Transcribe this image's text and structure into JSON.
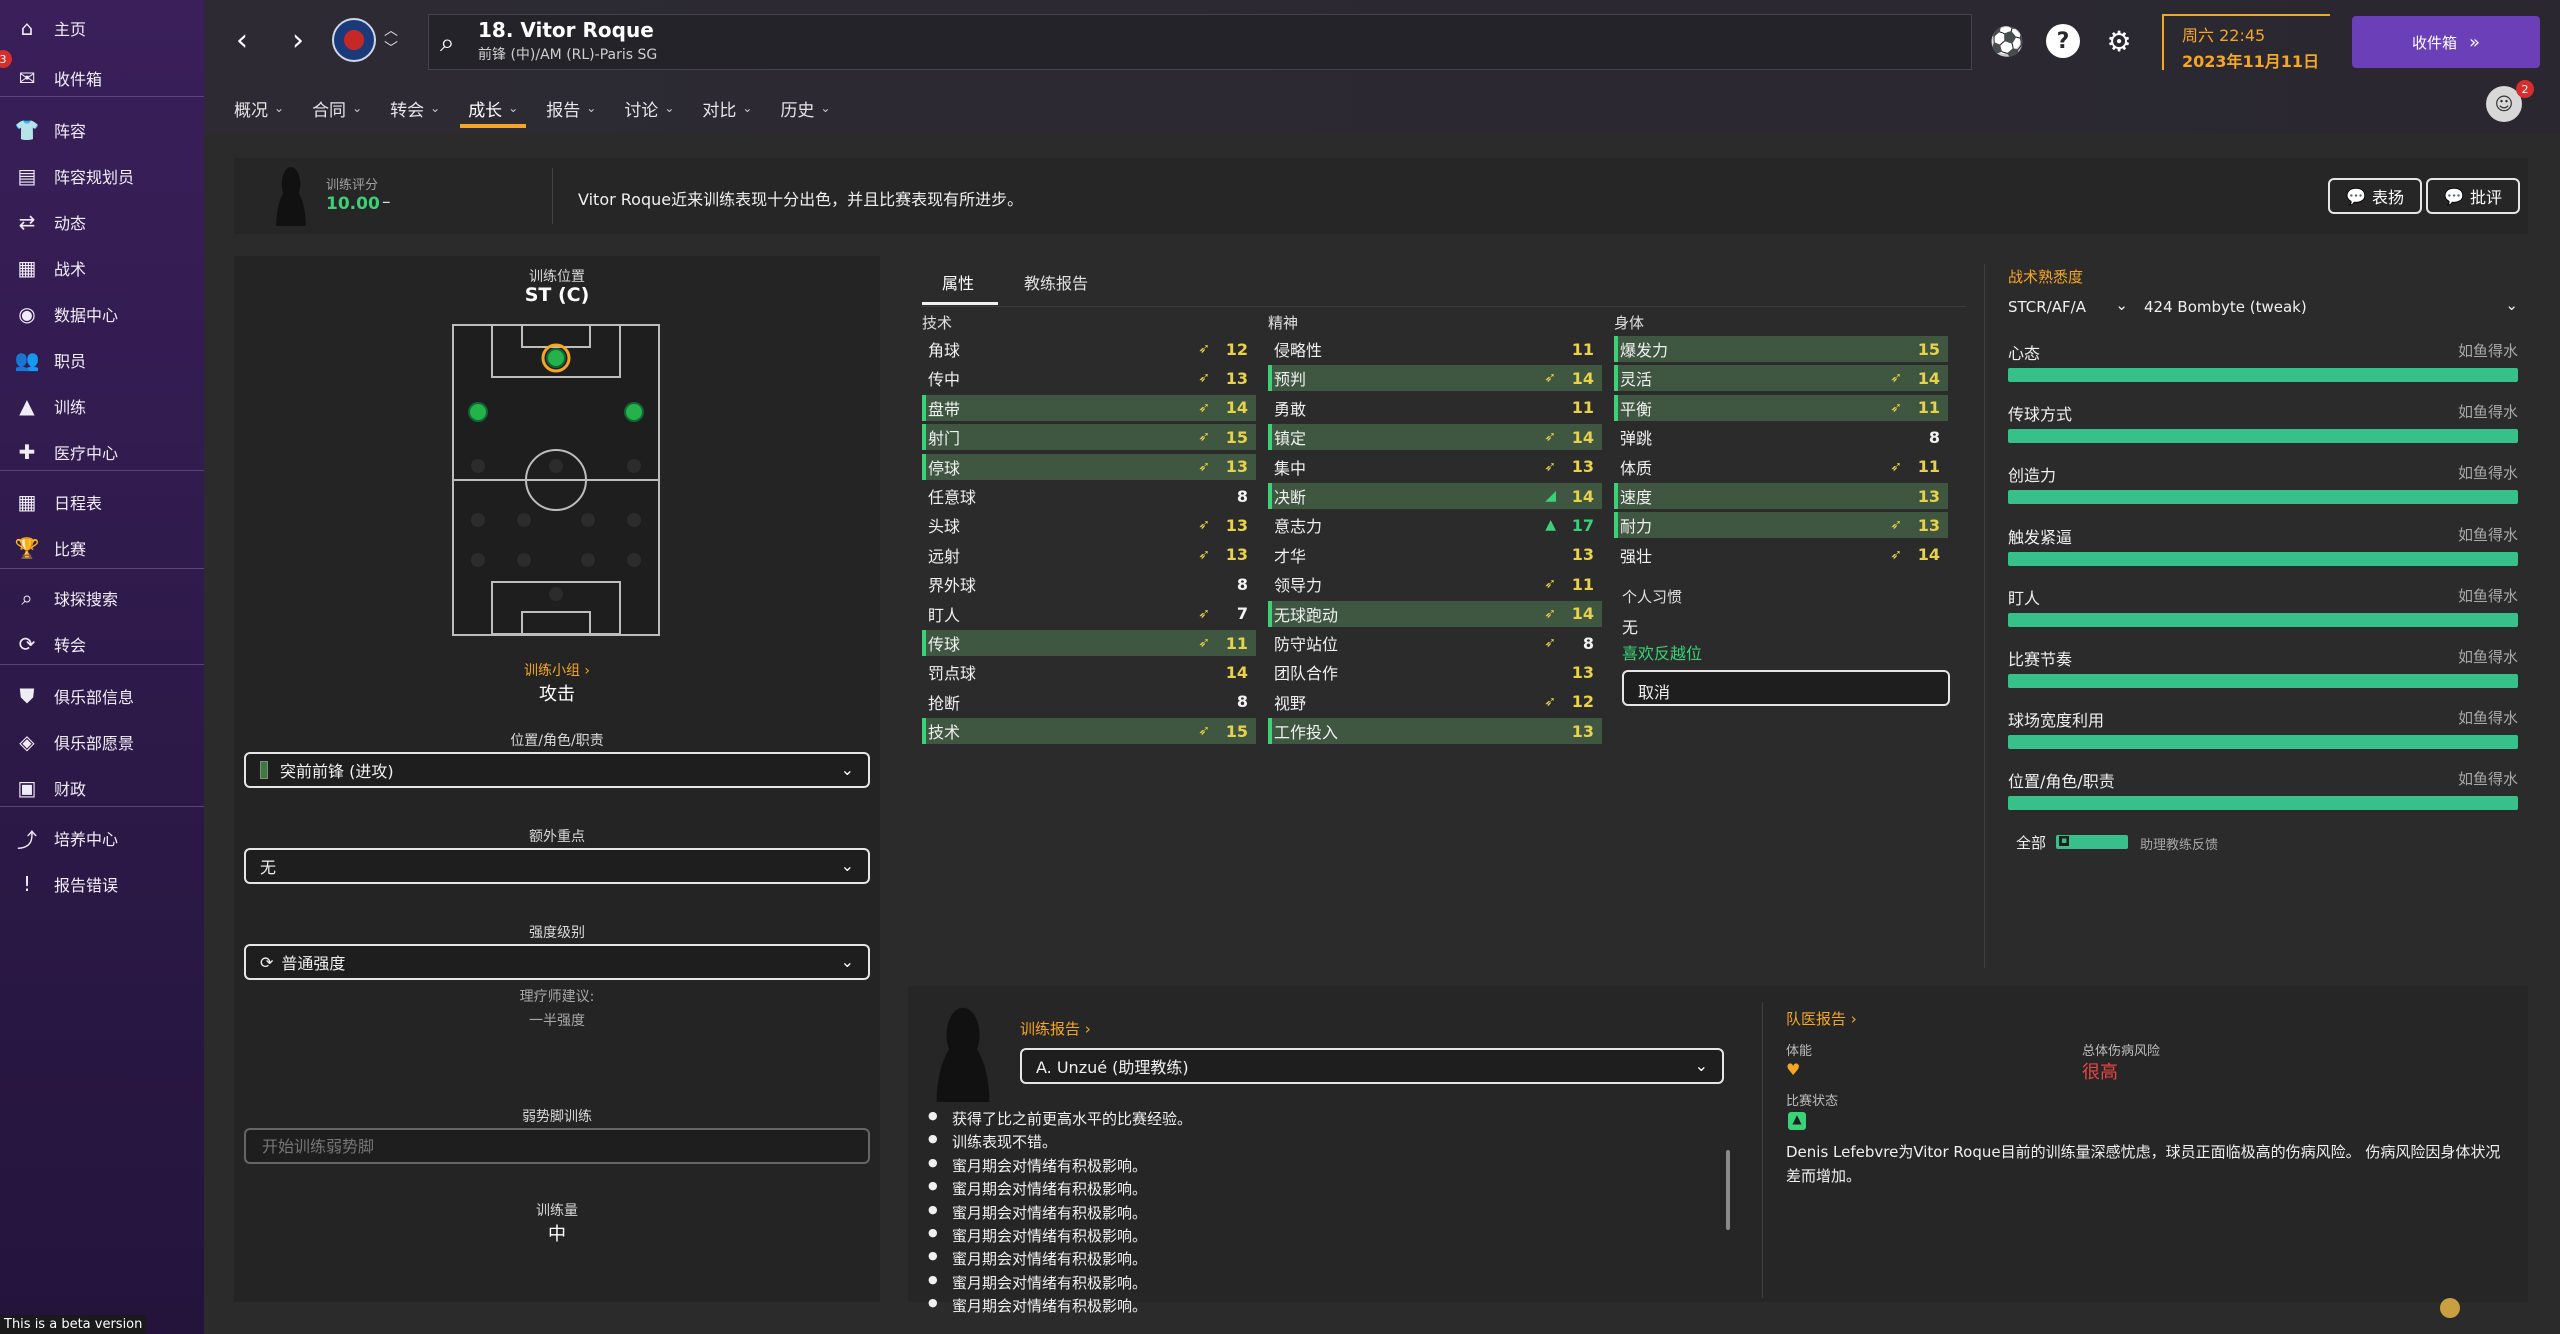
{
  "sidebar": {
    "items": [
      {
        "label": "主页",
        "icon": "home-icon",
        "glyph": "⌂"
      },
      {
        "label": "收件箱",
        "icon": "inbox-icon",
        "glyph": "✉",
        "badge": "3"
      },
      {
        "label": "阵容",
        "icon": "squad-icon",
        "glyph": "👕"
      },
      {
        "label": "阵容规划员",
        "icon": "squad-planner-icon",
        "glyph": "▤"
      },
      {
        "label": "动态",
        "icon": "dynamics-icon",
        "glyph": "⇄"
      },
      {
        "label": "战术",
        "icon": "tactics-icon",
        "glyph": "▦"
      },
      {
        "label": "数据中心",
        "icon": "data-hub-icon",
        "glyph": "◉"
      },
      {
        "label": "职员",
        "icon": "staff-icon",
        "glyph": "👥"
      },
      {
        "label": "训练",
        "icon": "training-icon",
        "glyph": "▲"
      },
      {
        "label": "医疗中心",
        "icon": "medical-icon",
        "glyph": "✚"
      },
      {
        "label": "日程表",
        "icon": "schedule-icon",
        "glyph": "▦"
      },
      {
        "label": "比赛",
        "icon": "competitions-icon",
        "glyph": "🏆"
      },
      {
        "label": "球探搜索",
        "icon": "scouting-icon",
        "glyph": "⌕"
      },
      {
        "label": "转会",
        "icon": "transfers-icon",
        "glyph": "⟳"
      },
      {
        "label": "俱乐部信息",
        "icon": "club-info-icon",
        "glyph": "⛊"
      },
      {
        "label": "俱乐部愿景",
        "icon": "club-vision-icon",
        "glyph": "◈"
      },
      {
        "label": "财政",
        "icon": "finances-icon",
        "glyph": "▣"
      },
      {
        "label": "培养中心",
        "icon": "development-icon",
        "glyph": "⤴"
      },
      {
        "label": "报告错误",
        "icon": "report-bug-icon",
        "glyph": "!"
      }
    ],
    "beta": "This is a beta version"
  },
  "header": {
    "title": "18. Vitor Roque",
    "subtitle": "前锋 (中)/AM (RL)-Paris SG",
    "time": "周六 22:45",
    "date": "2023年11月11日",
    "inbox": "收件箱",
    "manager_badge": "2",
    "menu": [
      {
        "label": "概况"
      },
      {
        "label": "合同"
      },
      {
        "label": "转会"
      },
      {
        "label": "成长"
      },
      {
        "label": "报告"
      },
      {
        "label": "讨论"
      },
      {
        "label": "对比"
      },
      {
        "label": "历史"
      }
    ]
  },
  "rating": {
    "label": "训练评分",
    "value": "10.00",
    "trend": "–",
    "comment": "Vitor Roque近来训练表现十分出色，并且比赛表现有所进步。",
    "praise": "表扬",
    "criticise": "批评"
  },
  "left": {
    "position_label": "训练位置",
    "position_value": "ST (C)",
    "unit_label": "训练小组",
    "unit_value": "攻击",
    "role_label": "位置/角色/职责",
    "role_value": "突前前锋 (进攻)",
    "extra_label": "额外重点",
    "extra_value": "无",
    "intensity_label": "强度级别",
    "intensity_value": "普通强度",
    "physio_label": "理疗师建议:",
    "physio_value": "一半强度",
    "weakfoot_label": "弱势脚训练",
    "weakfoot_placeholder": "开始训练弱势脚",
    "load_label": "训练量",
    "load_value": "中"
  },
  "attributes": {
    "tabs": [
      "属性",
      "教练报告"
    ],
    "technical_head": "技术",
    "mental_head": "精神",
    "physical_head": "身体",
    "technical": [
      {
        "name": "角球",
        "value": "12",
        "arrow": "up",
        "hl": false
      },
      {
        "name": "传中",
        "value": "13",
        "arrow": "up",
        "hl": false
      },
      {
        "name": "盘带",
        "value": "14",
        "arrow": "up",
        "hl": true
      },
      {
        "name": "射门",
        "value": "15",
        "arrow": "up",
        "hl": true
      },
      {
        "name": "停球",
        "value": "13",
        "arrow": "up",
        "hl": true
      },
      {
        "name": "任意球",
        "value": "8",
        "arrow": "",
        "hl": false
      },
      {
        "name": "头球",
        "value": "13",
        "arrow": "up",
        "hl": false
      },
      {
        "name": "远射",
        "value": "13",
        "arrow": "up",
        "hl": false
      },
      {
        "name": "界外球",
        "value": "8",
        "arrow": "",
        "hl": false
      },
      {
        "name": "盯人",
        "value": "7",
        "arrow": "up",
        "hl": false
      },
      {
        "name": "传球",
        "value": "11",
        "arrow": "up",
        "hl": true
      },
      {
        "name": "罚点球",
        "value": "14",
        "arrow": "",
        "hl": false
      },
      {
        "name": "抢断",
        "value": "8",
        "arrow": "",
        "hl": false
      },
      {
        "name": "技术",
        "value": "15",
        "arrow": "up",
        "hl": true
      }
    ],
    "mental": [
      {
        "name": "侵略性",
        "value": "11",
        "arrow": "",
        "hl": false
      },
      {
        "name": "预判",
        "value": "14",
        "arrow": "up",
        "hl": true
      },
      {
        "name": "勇敢",
        "value": "11",
        "arrow": "",
        "hl": false
      },
      {
        "name": "镇定",
        "value": "14",
        "arrow": "up",
        "hl": true
      },
      {
        "name": "集中",
        "value": "13",
        "arrow": "up",
        "hl": false
      },
      {
        "name": "决断",
        "value": "14",
        "arrow": "green",
        "hl": true
      },
      {
        "name": "意志力",
        "value": "17",
        "arrow": "green-strong",
        "hl": false
      },
      {
        "name": "才华",
        "value": "13",
        "arrow": "",
        "hl": false
      },
      {
        "name": "领导力",
        "value": "11",
        "arrow": "up",
        "hl": false
      },
      {
        "name": "无球跑动",
        "value": "14",
        "arrow": "up",
        "hl": true
      },
      {
        "name": "防守站位",
        "value": "8",
        "arrow": "up",
        "hl": false
      },
      {
        "name": "团队合作",
        "value": "13",
        "arrow": "",
        "hl": false
      },
      {
        "name": "视野",
        "value": "12",
        "arrow": "up",
        "hl": false
      },
      {
        "name": "工作投入",
        "value": "13",
        "arrow": "",
        "hl": true
      }
    ],
    "physical": [
      {
        "name": "爆发力",
        "value": "15",
        "arrow": "",
        "hl": true
      },
      {
        "name": "灵活",
        "value": "14",
        "arrow": "up",
        "hl": true
      },
      {
        "name": "平衡",
        "value": "11",
        "arrow": "up",
        "hl": true
      },
      {
        "name": "弹跳",
        "value": "8",
        "arrow": "",
        "hl": false
      },
      {
        "name": "体质",
        "value": "11",
        "arrow": "up",
        "hl": false
      },
      {
        "name": "速度",
        "value": "13",
        "arrow": "",
        "hl": true
      },
      {
        "name": "耐力",
        "value": "13",
        "arrow": "up",
        "hl": true
      },
      {
        "name": "强壮",
        "value": "14",
        "arrow": "up",
        "hl": false
      }
    ],
    "traits_head": "个人习惯",
    "traits_value": "无",
    "trait_training_label": "喜欢反越位",
    "trait_cancel": "取消"
  },
  "familiarity": {
    "title": "战术熟悉度",
    "position_select": "STCR/AF/A",
    "tactic_select": "424 Bombyte  (tweak)",
    "rows": [
      {
        "name": "心态",
        "status": "如鱼得水",
        "level": 1.0
      },
      {
        "name": "传球方式",
        "status": "如鱼得水",
        "level": 1.0
      },
      {
        "name": "创造力",
        "status": "如鱼得水",
        "level": 1.0
      },
      {
        "name": "触发紧逼",
        "status": "如鱼得水",
        "level": 1.0
      },
      {
        "name": "盯人",
        "status": "如鱼得水",
        "level": 1.0
      },
      {
        "name": "比赛节奏",
        "status": "如鱼得水",
        "level": 1.0
      },
      {
        "name": "球场宽度利用",
        "status": "如鱼得水",
        "level": 1.0
      },
      {
        "name": "位置/角色/职责",
        "status": "如鱼得水",
        "level": 1.0
      }
    ],
    "all_label": "全部",
    "assistant_feedback": "助理教练反馈"
  },
  "training_report": {
    "title": "训练报告",
    "coach": "A. Unzué (助理教练)",
    "lines": [
      "获得了比之前更高水平的比赛经验。",
      "训练表现不错。",
      "蜜月期会对情绪有积极影响。",
      "蜜月期会对情绪有积极影响。",
      "蜜月期会对情绪有积极影响。",
      "蜜月期会对情绪有积极影响。",
      "蜜月期会对情绪有积极影响。",
      "蜜月期会对情绪有积极影响。",
      "蜜月期会对情绪有积极影响。"
    ]
  },
  "medical": {
    "title": "队医报告",
    "condition_label": "体能",
    "injury_risk_label": "总体伤病风险",
    "injury_risk_value": "很高",
    "match_label": "比赛状态",
    "text": "Denis Lefebvre为Vitor Roque目前的训练量深感忧虑，球员正面临极高的伤病风险。 伤病风险因身体状况差而增加。"
  },
  "colors": {
    "accent": "#f5a623",
    "positive": "#3ad177",
    "sidebar": "#3a1f5a",
    "risk": "#e84545"
  }
}
